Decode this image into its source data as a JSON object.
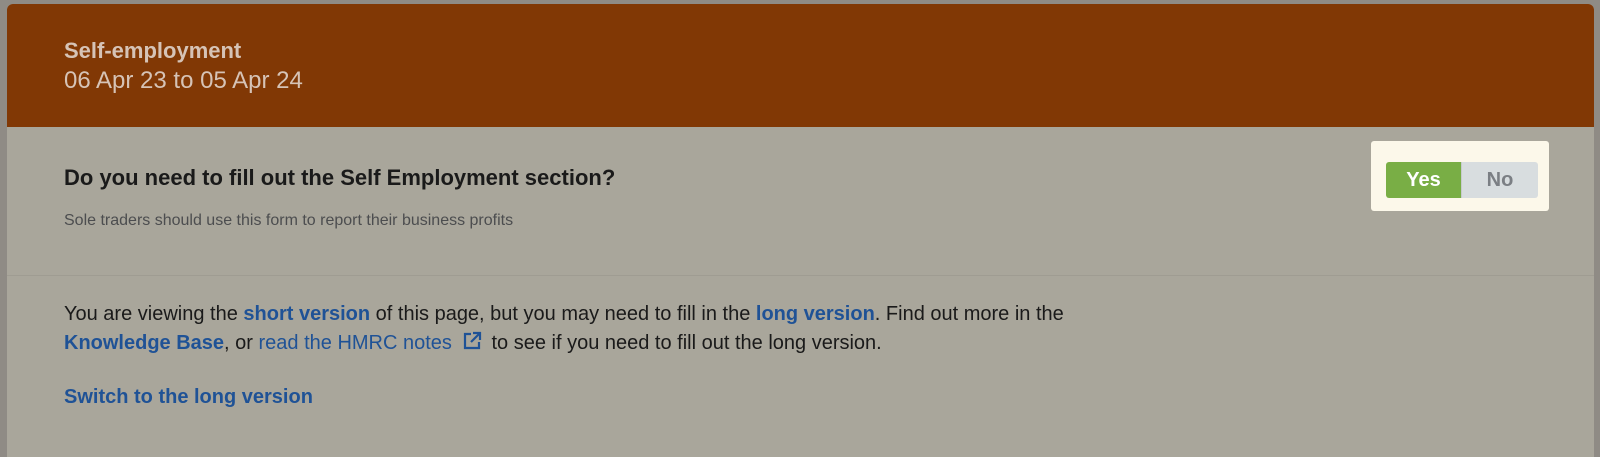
{
  "header": {
    "title": "Self-employment",
    "period": "06 Apr 23 to 05 Apr 24"
  },
  "question": {
    "title": "Do you need to fill out the Self Employment section?",
    "hint": "Sole traders should use this form to report their business profits",
    "yes_label": "Yes",
    "no_label": "No",
    "selected": "Yes"
  },
  "info": {
    "text_1": "You are viewing the ",
    "short_version_link": "short version",
    "text_2": " of this page, but you may need to fill in the ",
    "long_version_link": "long version",
    "text_3": ". Find out more in the",
    "knowledge_base_link": "Knowledge Base",
    "text_4": ", or ",
    "hmrc_notes_link": "read the HMRC notes",
    "external_icon": "external-link-icon",
    "text_5": " to see if you need to fill out the long version."
  },
  "switch_link": "Switch to the long version",
  "colors": {
    "header_bg": "#813805",
    "body_bg": "#a9a69b",
    "yes_green": "#79ae45",
    "link_blue": "#1f5296"
  }
}
